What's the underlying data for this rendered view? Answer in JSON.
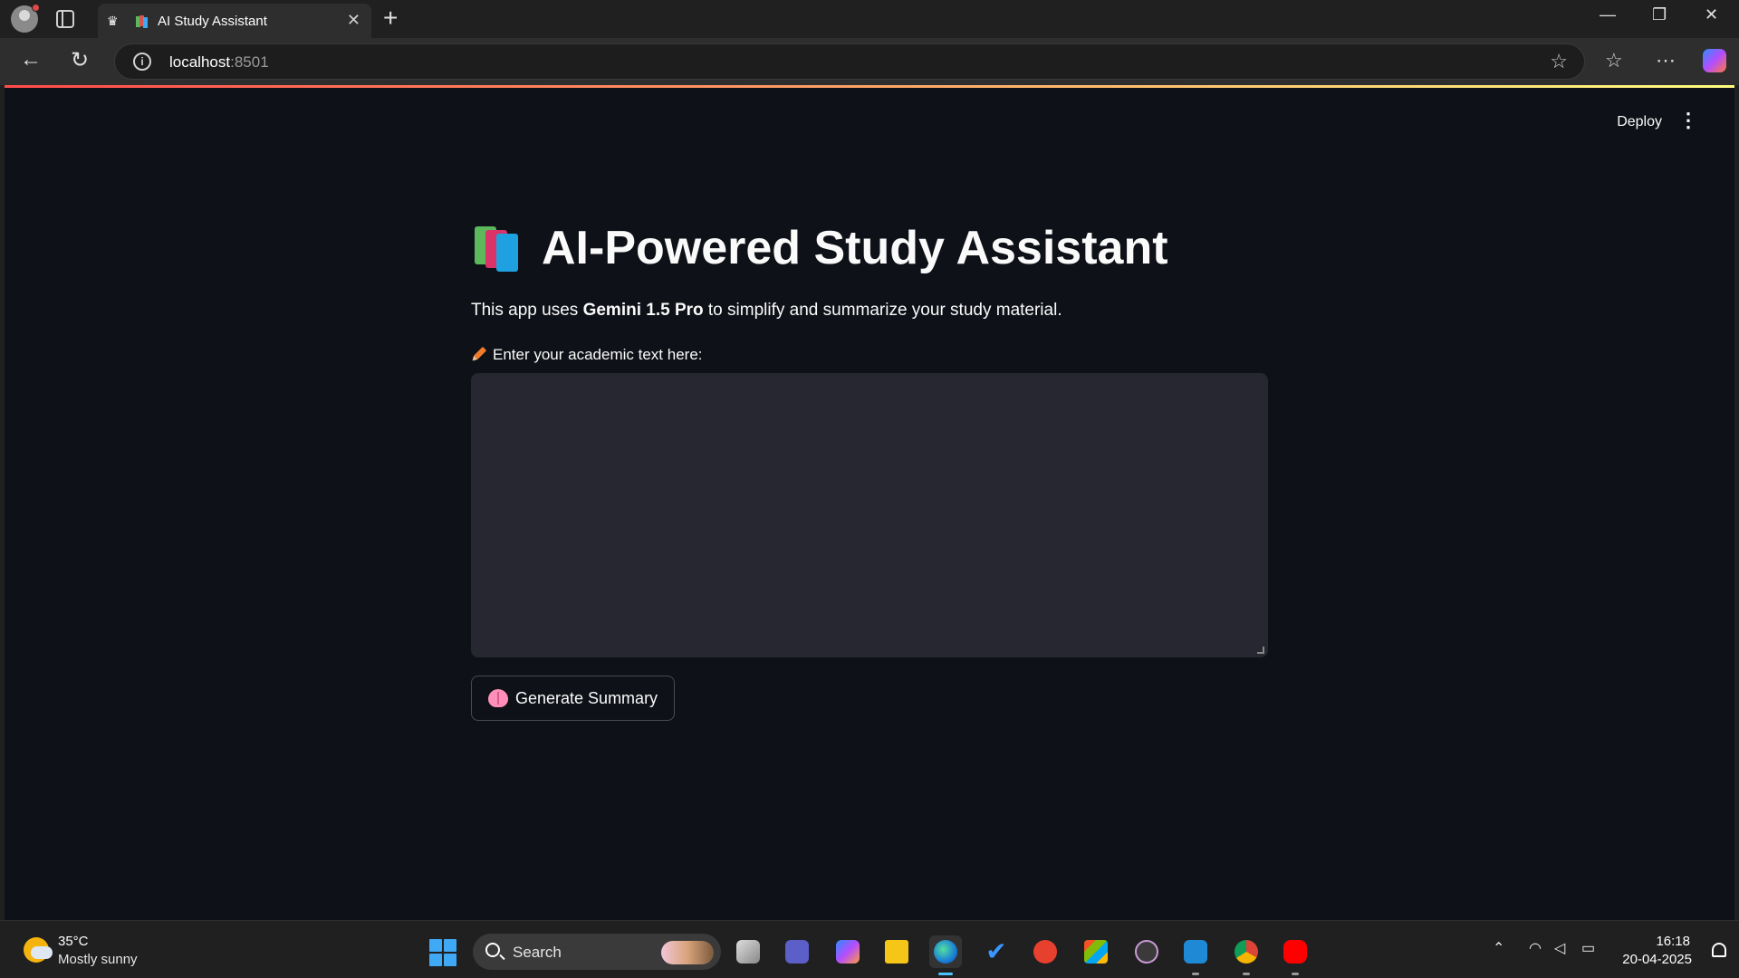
{
  "browser": {
    "tab_title": "AI Study Assistant",
    "url_host": "localhost",
    "url_port": ":8501",
    "window_controls": {
      "minimize": "—",
      "restore": "❐",
      "close": "✕"
    }
  },
  "app": {
    "deploy_label": "Deploy",
    "menu_icon": "⋮",
    "title": "AI-Powered Study Assistant",
    "description_prefix": "This app uses ",
    "description_bold": "Gemini 1.5 Pro",
    "description_suffix": " to simplify and summarize your study material.",
    "input_label": "Enter your academic text here:",
    "input_value": "",
    "button_label": "Generate Summary",
    "accent_colors": {
      "background": "#0e1117",
      "input": "#262730",
      "top_gradient_start": "#ff4b4b",
      "top_gradient_end": "#fffd80"
    }
  },
  "taskbar": {
    "temperature": "35°C",
    "condition": "Mostly sunny",
    "search_label": "Search",
    "time": "16:18",
    "date": "20-04-2025",
    "apps": [
      "task-view",
      "teams",
      "copilot",
      "file-explorer",
      "edge",
      "todo",
      "wps-office",
      "microsoft-store",
      "media-player",
      "vscode",
      "chrome",
      "youtube"
    ]
  }
}
